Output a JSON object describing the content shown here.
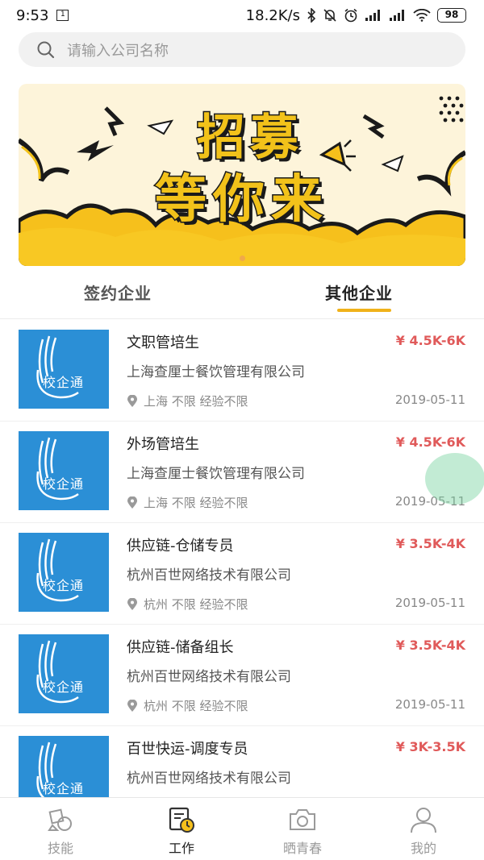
{
  "status_bar": {
    "time": "9:53",
    "sim_label": "1",
    "network_speed": "18.2K/s",
    "battery": "98"
  },
  "search": {
    "placeholder": "请输入公司名称"
  },
  "banner": {
    "line1": "招募",
    "line2": "等你来",
    "page_indicator": 1
  },
  "tabs": [
    {
      "label": "签约企业",
      "active": false
    },
    {
      "label": "其他企业",
      "active": true
    }
  ],
  "logo_text": "校企通",
  "jobs": [
    {
      "title": "文职管培生",
      "salary": "¥ 4.5K-6K",
      "company": "上海查厘士餐饮管理有限公司",
      "meta": "上海 不限 经验不限",
      "date": "2019-05-11"
    },
    {
      "title": "外场管培生",
      "salary": "¥ 4.5K-6K",
      "company": "上海查厘士餐饮管理有限公司",
      "meta": "上海 不限 经验不限",
      "date": "2019-05-11"
    },
    {
      "title": "供应链-仓储专员",
      "salary": "¥ 3.5K-4K",
      "company": "杭州百世网络技术有限公司",
      "meta": "杭州 不限 经验不限",
      "date": "2019-05-11"
    },
    {
      "title": "供应链-储备组长",
      "salary": "¥ 3.5K-4K",
      "company": "杭州百世网络技术有限公司",
      "meta": "杭州 不限 经验不限",
      "date": "2019-05-11"
    },
    {
      "title": "百世快运-调度专员",
      "salary": "¥ 3K-3.5K",
      "company": "杭州百世网络技术有限公司",
      "meta": "",
      "date": ""
    }
  ],
  "bottom_nav": [
    {
      "label": "技能",
      "icon": "skill-icon",
      "active": false
    },
    {
      "label": "工作",
      "icon": "work-icon",
      "active": true
    },
    {
      "label": "晒青春",
      "icon": "camera-icon",
      "active": false
    },
    {
      "label": "我的",
      "icon": "profile-icon",
      "active": false
    }
  ],
  "colors": {
    "accent": "#f0b21a",
    "salary": "#e05a5a",
    "logo_bg": "#2b8fd6"
  }
}
